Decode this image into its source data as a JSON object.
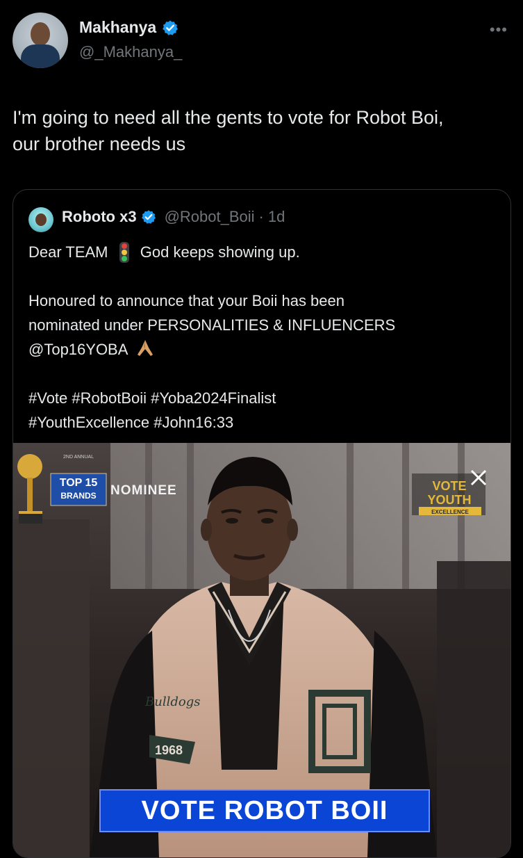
{
  "author": {
    "display_name": "Makhanya",
    "handle": "@_Makhanya_",
    "verified": true
  },
  "more_icon": "more-options-icon",
  "tweet": {
    "text_line1": "I'm going to need all the gents to vote for Robot Boi,",
    "text_line2": "our brother needs us"
  },
  "quote": {
    "display_name": "Roboto x3",
    "handle": "@Robot_Boii",
    "separator": "·",
    "time": "1d",
    "line1_a": "Dear TEAM",
    "line1_b": "God keeps showing up.",
    "para2_line1": "Honoured to announce that your Boii has been",
    "para2_line2": "nominated under PERSONALITIES & INFLUENCERS",
    "para2_line3": "@Top16YOBA",
    "hashtags_line1": "#Vote #RobotBoii #Yoba2024Finalist",
    "hashtags_line2": "#YouthExcellence #John16:33",
    "emoji_icons": [
      "traffic-light-icon",
      "folded-hands-icon"
    ]
  },
  "media": {
    "badge_small": "2ND ANNUAL",
    "badge_top": "TOP 15",
    "badge_bottom": "BRANDS",
    "nominee_label": "NOMINEE",
    "logo_line1": "VOTE",
    "logo_line2": "YOUTH",
    "logo_line3": "EXCELLENCE",
    "patch_text": "1968",
    "banner_text": "VOTE ROBOT BOII"
  },
  "colors": {
    "background": "#000000",
    "text": "#e7e9ea",
    "muted": "#71767b",
    "verified": "#1d9bf0",
    "border": "#2f3336",
    "banner": "#0a45d6"
  }
}
